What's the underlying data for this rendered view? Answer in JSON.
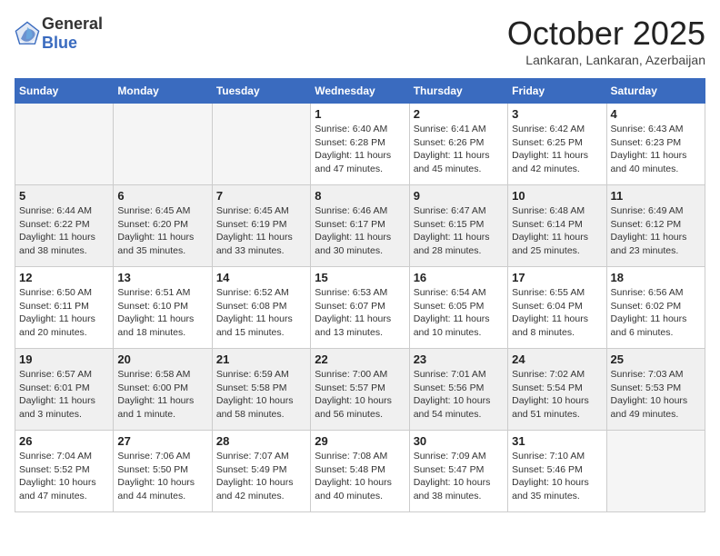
{
  "header": {
    "logo": {
      "general": "General",
      "blue": "Blue"
    },
    "title": "October 2025",
    "subtitle": "Lankaran, Lankaran, Azerbaijan"
  },
  "weekdays": [
    "Sunday",
    "Monday",
    "Tuesday",
    "Wednesday",
    "Thursday",
    "Friday",
    "Saturday"
  ],
  "weeks": [
    {
      "shaded": false,
      "days": [
        {
          "num": "",
          "info": ""
        },
        {
          "num": "",
          "info": ""
        },
        {
          "num": "",
          "info": ""
        },
        {
          "num": "1",
          "info": "Sunrise: 6:40 AM\nSunset: 6:28 PM\nDaylight: 11 hours and 47 minutes."
        },
        {
          "num": "2",
          "info": "Sunrise: 6:41 AM\nSunset: 6:26 PM\nDaylight: 11 hours and 45 minutes."
        },
        {
          "num": "3",
          "info": "Sunrise: 6:42 AM\nSunset: 6:25 PM\nDaylight: 11 hours and 42 minutes."
        },
        {
          "num": "4",
          "info": "Sunrise: 6:43 AM\nSunset: 6:23 PM\nDaylight: 11 hours and 40 minutes."
        }
      ]
    },
    {
      "shaded": true,
      "days": [
        {
          "num": "5",
          "info": "Sunrise: 6:44 AM\nSunset: 6:22 PM\nDaylight: 11 hours and 38 minutes."
        },
        {
          "num": "6",
          "info": "Sunrise: 6:45 AM\nSunset: 6:20 PM\nDaylight: 11 hours and 35 minutes."
        },
        {
          "num": "7",
          "info": "Sunrise: 6:45 AM\nSunset: 6:19 PM\nDaylight: 11 hours and 33 minutes."
        },
        {
          "num": "8",
          "info": "Sunrise: 6:46 AM\nSunset: 6:17 PM\nDaylight: 11 hours and 30 minutes."
        },
        {
          "num": "9",
          "info": "Sunrise: 6:47 AM\nSunset: 6:15 PM\nDaylight: 11 hours and 28 minutes."
        },
        {
          "num": "10",
          "info": "Sunrise: 6:48 AM\nSunset: 6:14 PM\nDaylight: 11 hours and 25 minutes."
        },
        {
          "num": "11",
          "info": "Sunrise: 6:49 AM\nSunset: 6:12 PM\nDaylight: 11 hours and 23 minutes."
        }
      ]
    },
    {
      "shaded": false,
      "days": [
        {
          "num": "12",
          "info": "Sunrise: 6:50 AM\nSunset: 6:11 PM\nDaylight: 11 hours and 20 minutes."
        },
        {
          "num": "13",
          "info": "Sunrise: 6:51 AM\nSunset: 6:10 PM\nDaylight: 11 hours and 18 minutes."
        },
        {
          "num": "14",
          "info": "Sunrise: 6:52 AM\nSunset: 6:08 PM\nDaylight: 11 hours and 15 minutes."
        },
        {
          "num": "15",
          "info": "Sunrise: 6:53 AM\nSunset: 6:07 PM\nDaylight: 11 hours and 13 minutes."
        },
        {
          "num": "16",
          "info": "Sunrise: 6:54 AM\nSunset: 6:05 PM\nDaylight: 11 hours and 10 minutes."
        },
        {
          "num": "17",
          "info": "Sunrise: 6:55 AM\nSunset: 6:04 PM\nDaylight: 11 hours and 8 minutes."
        },
        {
          "num": "18",
          "info": "Sunrise: 6:56 AM\nSunset: 6:02 PM\nDaylight: 11 hours and 6 minutes."
        }
      ]
    },
    {
      "shaded": true,
      "days": [
        {
          "num": "19",
          "info": "Sunrise: 6:57 AM\nSunset: 6:01 PM\nDaylight: 11 hours and 3 minutes."
        },
        {
          "num": "20",
          "info": "Sunrise: 6:58 AM\nSunset: 6:00 PM\nDaylight: 11 hours and 1 minute."
        },
        {
          "num": "21",
          "info": "Sunrise: 6:59 AM\nSunset: 5:58 PM\nDaylight: 10 hours and 58 minutes."
        },
        {
          "num": "22",
          "info": "Sunrise: 7:00 AM\nSunset: 5:57 PM\nDaylight: 10 hours and 56 minutes."
        },
        {
          "num": "23",
          "info": "Sunrise: 7:01 AM\nSunset: 5:56 PM\nDaylight: 10 hours and 54 minutes."
        },
        {
          "num": "24",
          "info": "Sunrise: 7:02 AM\nSunset: 5:54 PM\nDaylight: 10 hours and 51 minutes."
        },
        {
          "num": "25",
          "info": "Sunrise: 7:03 AM\nSunset: 5:53 PM\nDaylight: 10 hours and 49 minutes."
        }
      ]
    },
    {
      "shaded": false,
      "days": [
        {
          "num": "26",
          "info": "Sunrise: 7:04 AM\nSunset: 5:52 PM\nDaylight: 10 hours and 47 minutes."
        },
        {
          "num": "27",
          "info": "Sunrise: 7:06 AM\nSunset: 5:50 PM\nDaylight: 10 hours and 44 minutes."
        },
        {
          "num": "28",
          "info": "Sunrise: 7:07 AM\nSunset: 5:49 PM\nDaylight: 10 hours and 42 minutes."
        },
        {
          "num": "29",
          "info": "Sunrise: 7:08 AM\nSunset: 5:48 PM\nDaylight: 10 hours and 40 minutes."
        },
        {
          "num": "30",
          "info": "Sunrise: 7:09 AM\nSunset: 5:47 PM\nDaylight: 10 hours and 38 minutes."
        },
        {
          "num": "31",
          "info": "Sunrise: 7:10 AM\nSunset: 5:46 PM\nDaylight: 10 hours and 35 minutes."
        },
        {
          "num": "",
          "info": ""
        }
      ]
    }
  ]
}
